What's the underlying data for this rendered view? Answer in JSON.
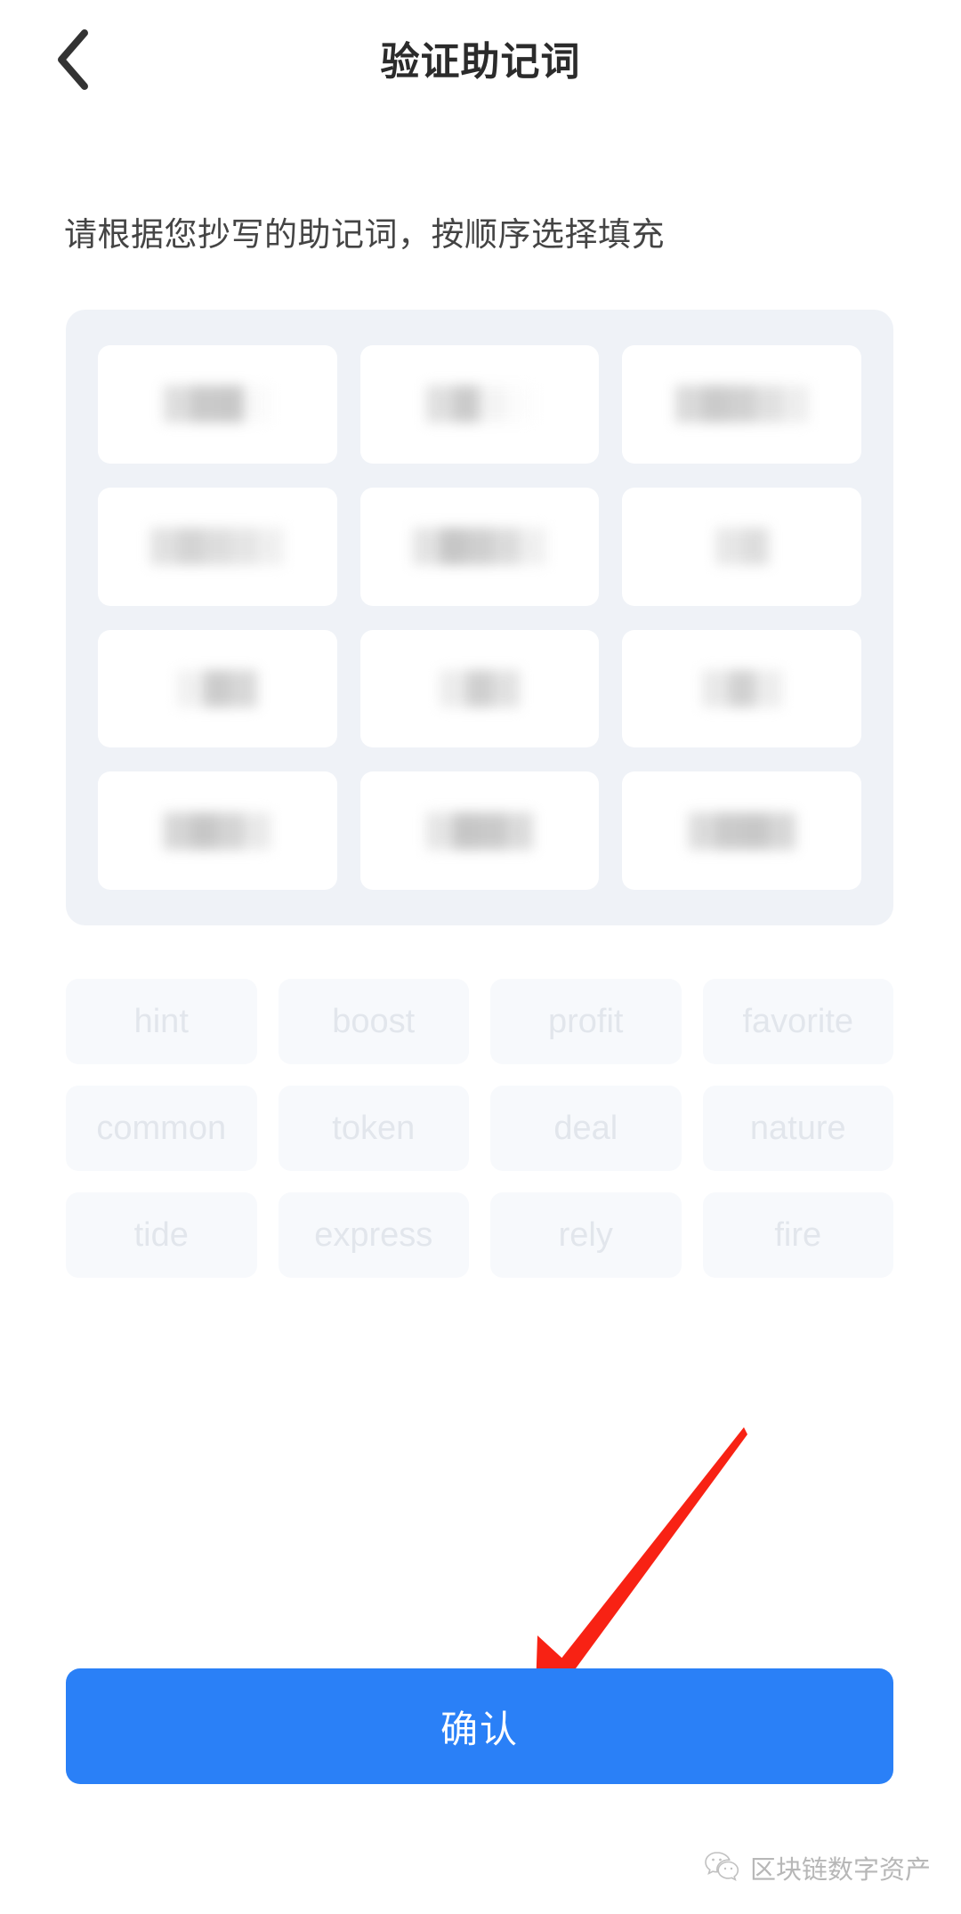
{
  "header": {
    "back_icon": "chevron-left-icon",
    "title": "验证助记词"
  },
  "body": {
    "instruction": "请根据您抄写的助记词，按顺序选择填充"
  },
  "mnemonic_slots": {
    "count": 12,
    "state": "redacted",
    "note": "已填充的助记词被打码隐藏"
  },
  "word_bank": {
    "rows": [
      [
        "hint",
        "boost",
        "profit",
        "favorite"
      ],
      [
        "common",
        "token",
        "deal",
        "nature"
      ],
      [
        "tide",
        "express",
        "rely",
        "fire"
      ]
    ],
    "words": [
      "hint",
      "boost",
      "profit",
      "favorite",
      "common",
      "token",
      "deal",
      "nature",
      "tide",
      "express",
      "rely",
      "fire"
    ]
  },
  "annotation": {
    "type": "arrow",
    "color": "#f82214",
    "points_to": "confirm-button"
  },
  "footer": {
    "confirm_label": "确认",
    "confirm_color": "#2a80f7"
  },
  "watermark": {
    "icon": "wechat-icon",
    "text": "区块链数字资产"
  }
}
